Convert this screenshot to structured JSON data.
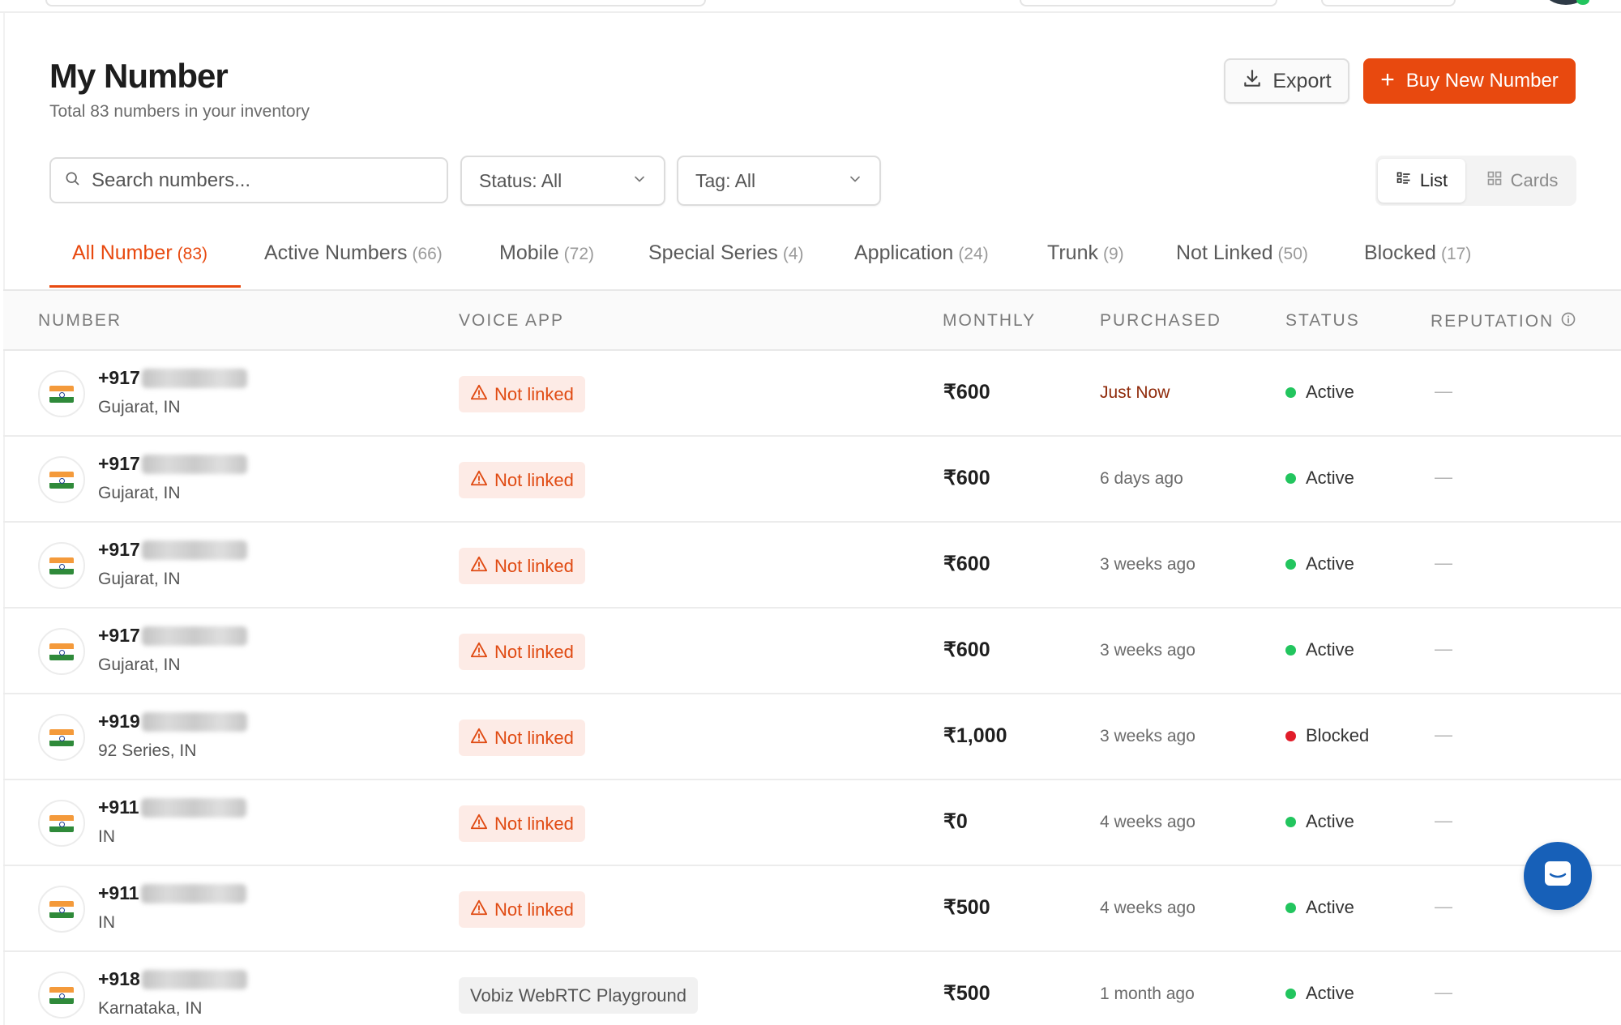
{
  "header": {
    "title": "My Number",
    "subtitle": "Total 83 numbers in your inventory"
  },
  "actions": {
    "export_label": "Export",
    "buy_label": "Buy New Number"
  },
  "filters": {
    "search_placeholder": "Search numbers...",
    "status_label": "Status: All",
    "tag_label": "Tag: All"
  },
  "view_toggle": {
    "list_label": "List",
    "cards_label": "Cards",
    "selected": "List"
  },
  "tabs": [
    {
      "label": "All Number",
      "count": "(83)",
      "active": true
    },
    {
      "label": "Active Numbers",
      "count": "(66)"
    },
    {
      "label": "Mobile",
      "count": "(72)"
    },
    {
      "label": "Special Series",
      "count": "(4)"
    },
    {
      "label": "Application",
      "count": "(24)"
    },
    {
      "label": "Trunk",
      "count": "(9)"
    },
    {
      "label": "Not Linked",
      "count": "(50)"
    },
    {
      "label": "Blocked",
      "count": "(17)"
    }
  ],
  "table": {
    "columns": [
      "NUMBER",
      "VOICE APP",
      "MONTHLY",
      "PURCHASED",
      "STATUS",
      "REPUTATION"
    ],
    "rows": [
      {
        "number_prefix": "+917",
        "region": "Gujarat, IN",
        "voice_app": "Not linked",
        "voice_app_linked": false,
        "monthly": "₹600",
        "purchased": "Just Now",
        "status": "Active",
        "reputation": "—"
      },
      {
        "number_prefix": "+917",
        "region": "Gujarat, IN",
        "voice_app": "Not linked",
        "voice_app_linked": false,
        "monthly": "₹600",
        "purchased": "6 days ago",
        "status": "Active",
        "reputation": "—"
      },
      {
        "number_prefix": "+917",
        "region": "Gujarat, IN",
        "voice_app": "Not linked",
        "voice_app_linked": false,
        "monthly": "₹600",
        "purchased": "3 weeks ago",
        "status": "Active",
        "reputation": "—"
      },
      {
        "number_prefix": "+917",
        "region": "Gujarat, IN",
        "voice_app": "Not linked",
        "voice_app_linked": false,
        "monthly": "₹600",
        "purchased": "3 weeks ago",
        "status": "Active",
        "reputation": "—"
      },
      {
        "number_prefix": "+919",
        "region": "92 Series, IN",
        "voice_app": "Not linked",
        "voice_app_linked": false,
        "monthly": "₹1,000",
        "purchased": "3 weeks ago",
        "status": "Blocked",
        "reputation": "—"
      },
      {
        "number_prefix": "+911",
        "region": "IN",
        "voice_app": "Not linked",
        "voice_app_linked": false,
        "monthly": "₹0",
        "purchased": "4 weeks ago",
        "status": "Active",
        "reputation": "—"
      },
      {
        "number_prefix": "+911",
        "region": "IN",
        "voice_app": "Not linked",
        "voice_app_linked": false,
        "monthly": "₹500",
        "purchased": "4 weeks ago",
        "status": "Active",
        "reputation": "—"
      },
      {
        "number_prefix": "+918",
        "region": "Karnataka, IN",
        "voice_app": "Vobiz WebRTC Playground",
        "voice_app_linked": true,
        "monthly": "₹500",
        "purchased": "1 month ago",
        "status": "Active",
        "reputation": "—"
      }
    ]
  },
  "icons": {
    "export": "download-icon",
    "buy": "plus-icon",
    "search": "search-icon",
    "dropdown": "chevron-down-icon",
    "list": "list-icon",
    "cards": "grid-icon",
    "warning": "warning-triangle-icon",
    "flag": "india-flag-icon",
    "info": "info-icon",
    "chat": "chat-icon"
  },
  "colors": {
    "accent": "#e8490f",
    "active_dot": "#22c55e",
    "blocked_dot": "#e11d2a",
    "chat_fab": "#1760b8"
  }
}
